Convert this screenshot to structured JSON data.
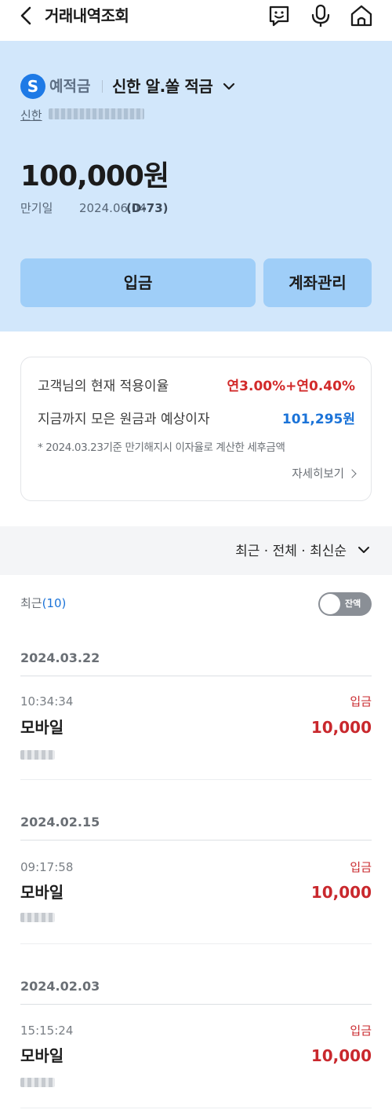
{
  "header": {
    "title": "거래내역조회",
    "icons": [
      "back-arrow-icon",
      "chatbot-icon",
      "microphone-icon",
      "home-icon"
    ]
  },
  "account": {
    "logo_letter": "S",
    "type": "예적금",
    "name": "신한 알.쏠 적금",
    "bank": "신한",
    "balance": "100,000원",
    "maturity_label": "만기일",
    "maturity_date": "2024.06.04",
    "dday": "(D-73)",
    "deposit_button": "입금",
    "manage_button": "계좌관리"
  },
  "interest": {
    "rate_label": "고객님의 현재 적용이율",
    "rate_value": "연3.00%+연0.40%",
    "expected_label": "지금까지 모은 원금과 예상이자",
    "expected_value": "101,295원",
    "note": "* 2024.03.23기준 만기해지시 이자율로 계산한 세후금액",
    "detail_link": "자세히보기"
  },
  "sort": {
    "label": "최근 · 전체 · 최신순"
  },
  "filter": {
    "recent_label": "최근",
    "recent_count": "(10)",
    "toggle_label": "잔액",
    "toggle_on": false
  },
  "transactions": [
    {
      "date": "2024.03.22",
      "time": "10:34:34",
      "type": "입금",
      "title": "모바일",
      "amount": "10,000"
    },
    {
      "date": "2024.02.15",
      "time": "09:17:58",
      "type": "입금",
      "title": "모바일",
      "amount": "10,000"
    },
    {
      "date": "2024.02.03",
      "time": "15:15:24",
      "type": "입금",
      "title": "모바일",
      "amount": "10,000"
    }
  ],
  "colors": {
    "panel_bg": "#d2e7fb",
    "button_bg": "#9fcef8",
    "deposit_red": "#c9282d",
    "accent_blue": "#1b73d8"
  }
}
